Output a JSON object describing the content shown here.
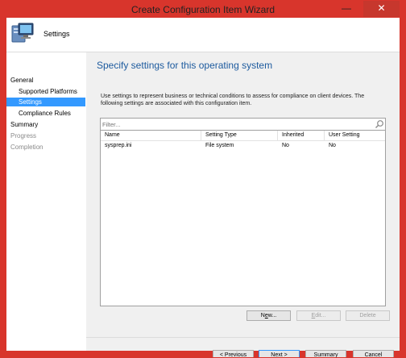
{
  "window": {
    "title": "Create Configuration Item Wizard",
    "minimize_glyph": "—",
    "close_glyph": "✕",
    "frame_color": "#d8352c"
  },
  "header": {
    "icon": "computer-icon",
    "title": "Settings"
  },
  "nav": {
    "items": [
      {
        "label": "General",
        "level": "top",
        "state": "normal"
      },
      {
        "label": "Supported Platforms",
        "level": "sub",
        "state": "normal"
      },
      {
        "label": "Settings",
        "level": "sub",
        "state": "selected"
      },
      {
        "label": "Compliance Rules",
        "level": "sub",
        "state": "normal"
      },
      {
        "label": "Summary",
        "level": "top",
        "state": "normal"
      },
      {
        "label": "Progress",
        "level": "top",
        "state": "disabled"
      },
      {
        "label": "Completion",
        "level": "top",
        "state": "disabled"
      }
    ],
    "selected_color": "#3399ff"
  },
  "main": {
    "title": "Specify settings for this operating system",
    "title_color": "#1c5a9e",
    "description": "Use settings to represent business or technical conditions to assess for compliance on client devices. The following settings are associated with this configuration item.",
    "filter_placeholder": "Filter...",
    "columns": [
      "Name",
      "Setting Type",
      "Inherited",
      "User Setting"
    ],
    "rows": [
      [
        "sysprep.ini",
        "File system",
        "No",
        "No"
      ]
    ],
    "buttons": {
      "new": {
        "pre": "N",
        "mn": "e",
        "post": "w..."
      },
      "edit": {
        "pre": "",
        "mn": "E",
        "post": "dit..."
      },
      "delete": "Delete"
    }
  },
  "footer": {
    "prev": {
      "pre": "< ",
      "mn": "P",
      "post": "revious"
    },
    "next": {
      "pre": "",
      "mn": "N",
      "post": "ext >"
    },
    "summary": {
      "pre": "",
      "mn": "S",
      "post": "ummary"
    },
    "cancel": "Cancel"
  }
}
